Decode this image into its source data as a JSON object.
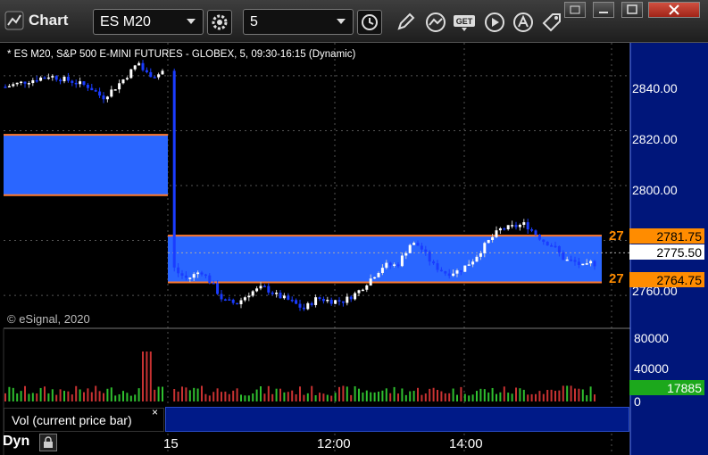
{
  "app": {
    "title": "Chart"
  },
  "toolbar": {
    "symbol": "ES M20",
    "interval": "5",
    "icons": [
      "gear-icon",
      "clock-icon",
      "pencil-icon",
      "line-draw-icon",
      "get-icon",
      "play-icon",
      "a-icon",
      "tag-icon"
    ]
  },
  "window_controls": [
    "restore-icon",
    "minimize-icon",
    "maximize-icon",
    "close-icon"
  ],
  "chart": {
    "info_text": "* ES M20, S&P 500 E-MINI FUTURES - GLOBEX, 5, 09:30-16:15 (Dynamic)",
    "copyright": "© eSignal, 2020",
    "study_label": "Vol (current price bar)",
    "study_close": "×",
    "status_label": "Dyn",
    "x_labels": [
      "15",
      "12:00",
      "14:00"
    ],
    "y_labels": [
      "2840.00",
      "2820.00",
      "2800.00",
      "2760.00"
    ],
    "vol_labels": [
      "80000",
      "40000",
      "0"
    ],
    "level_labels": [
      "27",
      "27"
    ],
    "tags": {
      "upper": "2781.75",
      "current": "2775.50",
      "lower": "2764.75",
      "volume": "17885"
    },
    "colors": {
      "zone": "#2a66ff",
      "zone_edge": "#ff7a30",
      "tag": "#ff8c00",
      "axis_bg": "#00167a",
      "vol_tag": "#1ca81c"
    }
  },
  "chart_data": {
    "type": "candlestick",
    "symbol": "ES M20",
    "y_range": [
      2748,
      2852
    ],
    "levels": {
      "zone1": [
        2796.5,
        2818.5
      ],
      "zone2": [
        2764.75,
        2781.75
      ],
      "last": 2775.5
    },
    "last_volume": 17885,
    "vol_range": [
      0,
      90000
    ]
  }
}
